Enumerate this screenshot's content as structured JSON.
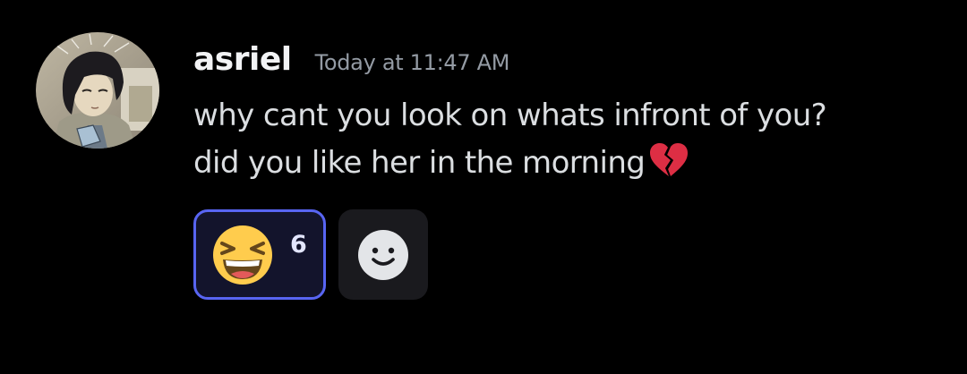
{
  "message": {
    "author": "asriel",
    "timestamp": "Today at 11:47 AM",
    "avatar": "user-avatar-illustration",
    "lines": [
      "why cant you look on whats infront of you?",
      "did you like her in the morning"
    ],
    "inline_emoji": "broken-heart-icon"
  },
  "reactions": [
    {
      "emoji": "laughing-face-icon",
      "count": "6",
      "selected": true
    }
  ],
  "add_reaction": {
    "icon": "add-reaction-smiley-icon"
  },
  "colors": {
    "background": "#000000",
    "username": "#f2f3f5",
    "timestamp": "#949ba4",
    "message_text": "#dbdee1",
    "reaction_selected_border": "#5865f2",
    "reaction_selected_bg": "#13142c",
    "add_reaction_bg": "#1a1a1e"
  }
}
